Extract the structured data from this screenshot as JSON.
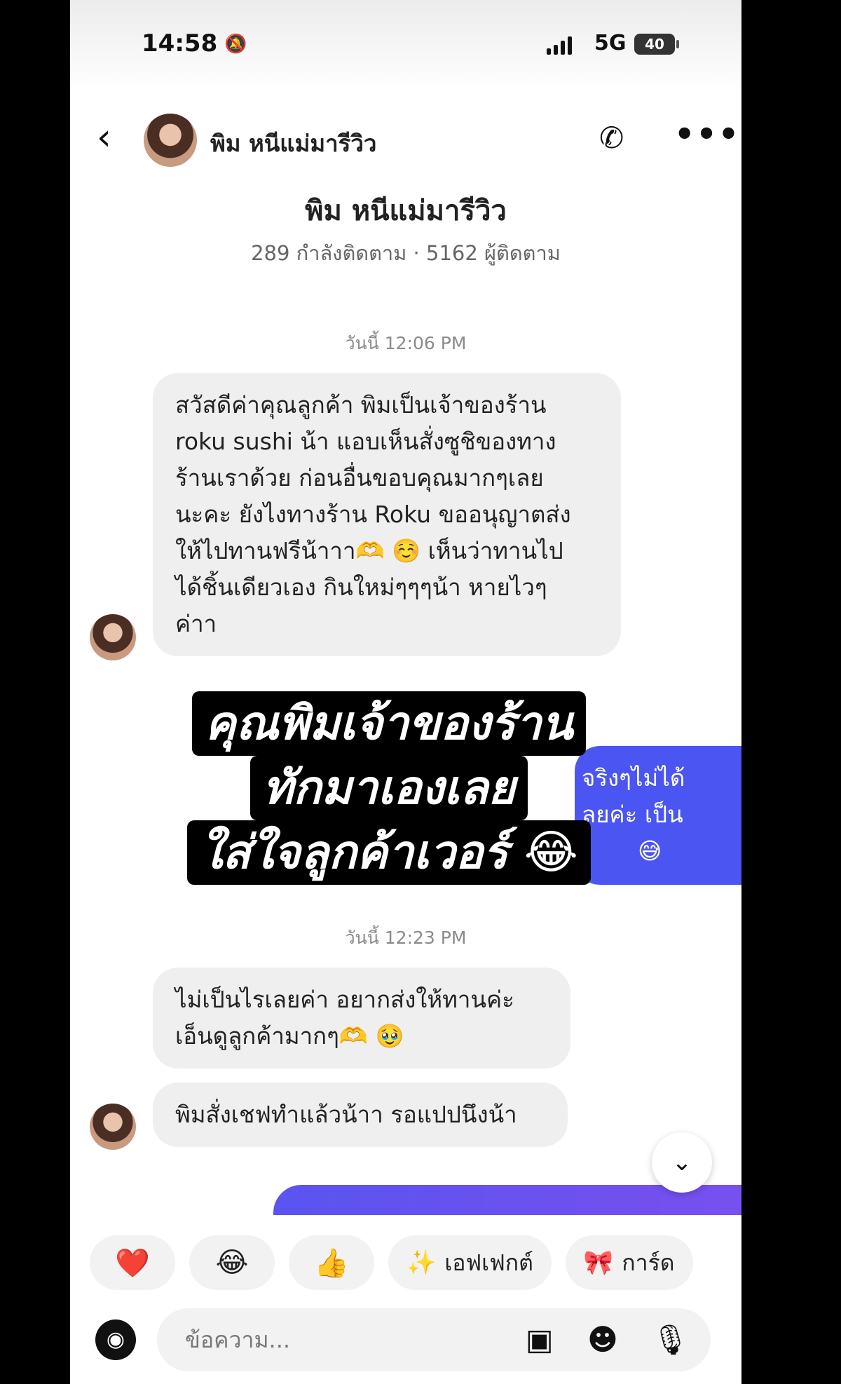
{
  "status_bar": {
    "time": "14:58",
    "network": "5G",
    "battery": "40"
  },
  "header": {
    "contact_name": "พิม หนีแม่มารีวิว",
    "back_glyph": "‹",
    "call_glyph": "✆",
    "more_glyph": "•••"
  },
  "profile": {
    "name": "พิม หนีแม่มารีวิว",
    "stats": "289 กำลังติดตาม · 5162 ผู้ติดตาม"
  },
  "timestamps": {
    "first": "วันนี้ 12:06 PM",
    "second": "วันนี้ 12:23 PM"
  },
  "messages": {
    "incoming_1": [
      "สวัสดีค่าคุณลูกค้า พิมเป็นเจ้าของร้าน",
      "roku sushi น้า แอบเห็นสั่งซูชิของทาง",
      "ร้านเราด้วย ก่อนอื่นขอบคุณมากๆเลย",
      "นะคะ ยังไงทางร้าน Roku ขออนุญาตส่ง",
      "ให้ไปทานฟรีน้าาา🫶 ☺️ เห็นว่าทานไป",
      "ได้ชิ้นเดียวเอง กินใหม่ๆๆๆน้า หายไวๆ",
      "ค่าา"
    ],
    "outgoing_1_partial": [
      "จริงๆไม่ได้",
      "ลยค่ะ เป็น",
      "😅"
    ],
    "incoming_2": [
      "ไม่เป็นไรเลยค่า อยากส่งให้ทานค่ะ",
      "เอ็นดูลูกค้ามากๆ🫶 🥹"
    ],
    "incoming_3": "พิมสั่งเชฟทำแล้วน้าา รอแปปนึงน้า"
  },
  "overlay_caption": [
    "คุณพิมเจ้าของร้าน",
    "ทักมาเองเลย",
    "ใส่ใจลูกค้าเวอร์ 😂"
  ],
  "reactions": {
    "heart": "❤️",
    "laugh": "😂",
    "thumbs": "👍",
    "effect_icon": "✨",
    "effect_label": "เอฟเฟกต์",
    "card_icon": "🎀",
    "card_label": "การ์ด"
  },
  "composer": {
    "placeholder": "ข้อความ...",
    "camera_glyph": "◉",
    "gallery_glyph": "▣",
    "sticker_glyph": "☻",
    "mic_glyph": "🎙"
  },
  "colors": {
    "outgoing_bubble": "#4a55f2",
    "incoming_bubble": "#efefef",
    "caption_bg": "#000000"
  }
}
